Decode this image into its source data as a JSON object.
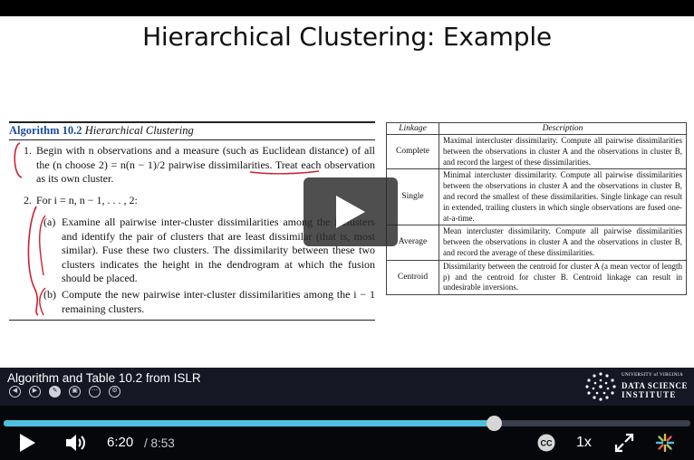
{
  "slide": {
    "title": "Hierarchical Clustering: Example",
    "algorithm": {
      "number": "Algorithm 10.2",
      "name": "Hierarchical Clustering",
      "step1_num": "1.",
      "step1_text": "Begin with n observations and a measure (such as Euclidean distance) of all the (n choose 2) = n(n − 1)/2 pairwise dissimilarities. Treat each observation as its own cluster.",
      "step2_num": "2.",
      "step2_text": "For i = n, n − 1, . . . , 2:",
      "sub_a_label": "(a)",
      "sub_a_text": "Examine all pairwise inter-cluster dissimilarities among the i clusters and identify the pair of clusters that are least dissimilar (that is, most similar). Fuse these two clusters. The dissimilarity between these two clusters indicates the height in the dendrogram at which the fusion should be placed.",
      "sub_b_label": "(b)",
      "sub_b_text": "Compute the new pairwise inter-cluster dissimilarities among the i − 1 remaining clusters."
    },
    "linkage_table": {
      "headers": [
        "Linkage",
        "Description"
      ],
      "rows": [
        {
          "linkage": "Complete",
          "description": "Maximal intercluster dissimilarity. Compute all pairwise dissimilarities between the observations in cluster A and the observations in cluster B, and record the largest of these dissimilarities."
        },
        {
          "linkage": "Single",
          "description": "Minimal intercluster dissimilarity. Compute all pairwise dissimilarities between the observations in cluster A and the observations in cluster B, and record the smallest of these dissimilarities. Single linkage can result in extended, trailing clusters in which single observations are fused one-at-a-time."
        },
        {
          "linkage": "Average",
          "description": "Mean intercluster dissimilarity. Compute all pairwise dissimilarities between the observations in cluster A and the observations in cluster B, and record the average of these dissimilarities."
        },
        {
          "linkage": "Centroid",
          "description": "Dissimilarity between the centroid for cluster A (a mean vector of length p) and the centroid for cluster B. Centroid linkage can result in undesirable inversions."
        }
      ]
    }
  },
  "player": {
    "video_title": "Algorithm and Table 10.2 from ISLR",
    "logo": {
      "line1": "UNIVERSITY of VIRGINIA",
      "line2": "DATA SCIENCE",
      "line3": "INSTITUTE"
    },
    "current_time": "6:20",
    "total_time": "/ 8:53",
    "speed": "1x",
    "progress_fraction": 0.714,
    "colors": {
      "progress_fill": "#4ebfdd",
      "bar_bg": "#151724",
      "controls_bg": "#06070b",
      "annotation": "#d02030"
    }
  }
}
